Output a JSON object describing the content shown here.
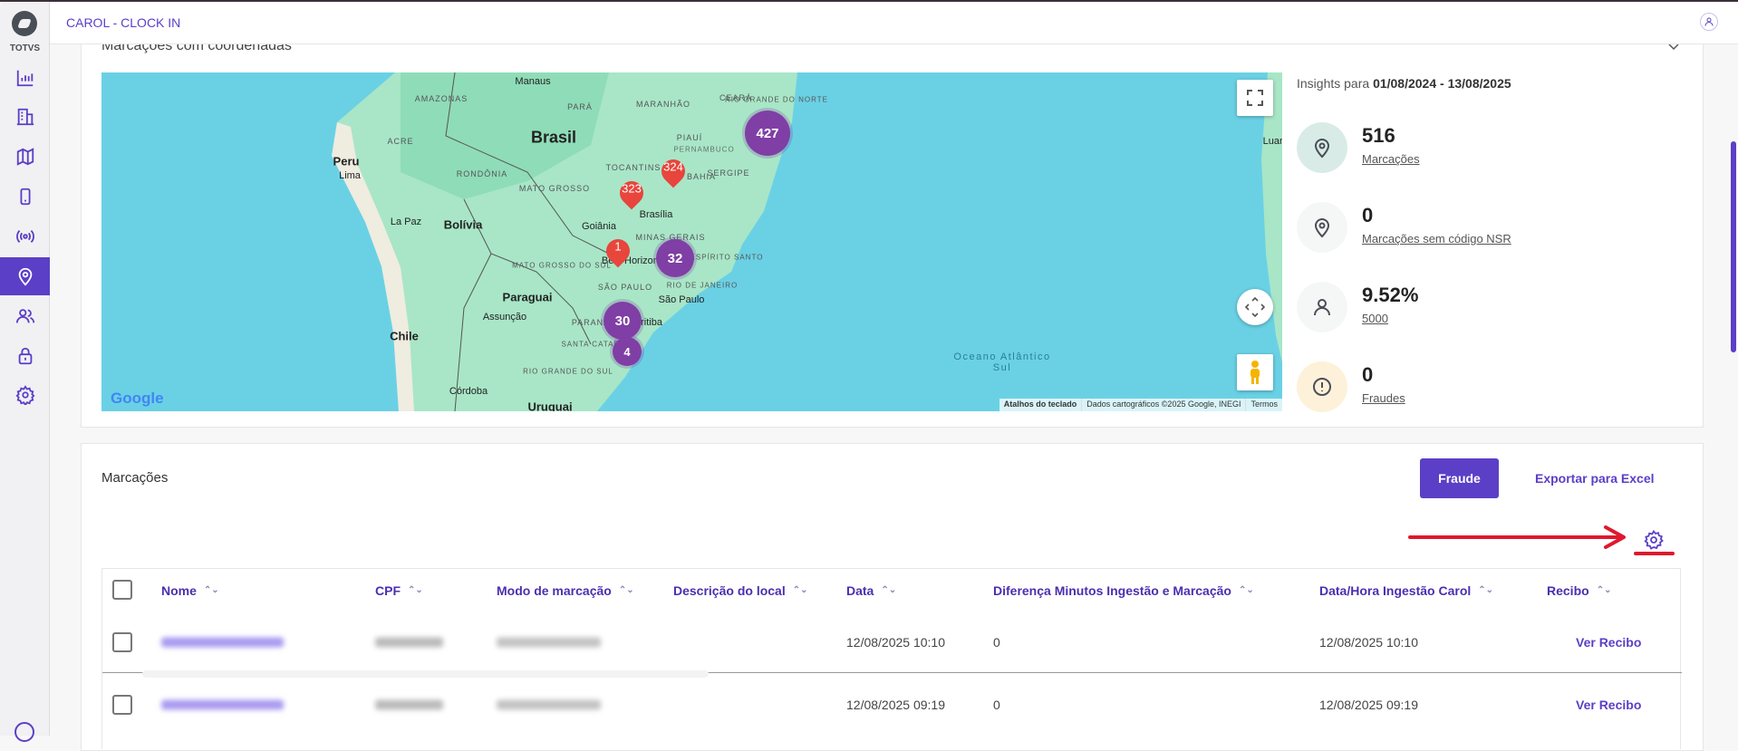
{
  "app": {
    "title": "CAROL - CLOCK IN",
    "brand": "TOTVS"
  },
  "sidebar": {
    "items": [
      {
        "name": "dashboard",
        "icon": "bar-chart-icon"
      },
      {
        "name": "companies",
        "icon": "building-icon"
      },
      {
        "name": "map",
        "icon": "map-icon"
      },
      {
        "name": "devices",
        "icon": "mobile-icon"
      },
      {
        "name": "signal",
        "icon": "broadcast-icon"
      },
      {
        "name": "locations",
        "icon": "location-pin-icon",
        "active": true
      },
      {
        "name": "users",
        "icon": "users-icon"
      },
      {
        "name": "security",
        "icon": "lock-icon"
      },
      {
        "name": "settings",
        "icon": "gear-icon"
      }
    ]
  },
  "map_card": {
    "title": "Marcações com coordenadas",
    "labels": {
      "countries": [
        "Brasil",
        "Peru",
        "Bolívia",
        "Paraguai",
        "Chile",
        "Uruguai"
      ],
      "cities": [
        "Manaus",
        "Lima",
        "La Paz",
        "Brasília",
        "Goiânia",
        "São Paulo",
        "Assunção",
        "Córdoba",
        "Belo Horizonte",
        "Curitiba",
        "Luanda"
      ],
      "states": [
        "AMAZONAS",
        "PARÁ",
        "MARANHÃO",
        "CEARÁ",
        "RIO GRANDE DO NORTE",
        "PIAUÍ",
        "PERNAMBUCO",
        "ACRE",
        "RONDÔNIA",
        "TOCANTINS",
        "BAHIA",
        "SERGIPE",
        "MATO GROSSO",
        "MINAS GERAIS",
        "ESPÍRITO SANTO",
        "MATO GROSSO DO SUL",
        "SÃO PAULO",
        "RIO DE JANEIRO",
        "PARANÁ",
        "SANTA CATARINA",
        "RIO GRANDE DO SUL"
      ],
      "ocean": "Oceano Atlântico Sul"
    },
    "clusters": [
      "427",
      "32",
      "30",
      "4"
    ],
    "pins": [
      "324",
      "323",
      "1"
    ],
    "google": "Google",
    "attribution": [
      "Atalhos do teclado",
      "Dados cartográficos ©2025 Google, INEGI",
      "Termos"
    ]
  },
  "insights": {
    "prefix": "Insights para",
    "range": "01/08/2024 - 13/08/2025",
    "items": [
      {
        "value": "516",
        "label": "Marcações",
        "icon": "location-pin-icon",
        "bg": "#d9ebe6"
      },
      {
        "value": "0",
        "label": "Marcações sem código NSR",
        "icon": "location-pin-icon",
        "bg": "#f5f7f7"
      },
      {
        "value": "9.52%",
        "label": "5000",
        "icon": "user-icon",
        "bg": "#f5f7f7"
      },
      {
        "value": "0",
        "label": "Fraudes",
        "icon": "alert-icon",
        "bg": "#fdf1d9"
      }
    ]
  },
  "marcacoes": {
    "title": "Marcações",
    "fraude_label": "Fraude",
    "export_label": "Exportar para Excel",
    "columns": [
      "Nome",
      "CPF",
      "Modo de marcação",
      "Descrição do local",
      "Data",
      "Diferença Minutos Ingestão e Marcação",
      "Data/Hora Ingestão Carol",
      "Recibo"
    ],
    "rows": [
      {
        "data": "12/08/2025 10:10",
        "diferenca": "0",
        "ingestao": "12/08/2025 10:10",
        "recibo": "Ver Recibo"
      },
      {
        "data": "12/08/2025 09:19",
        "diferenca": "0",
        "ingestao": "12/08/2025 09:19",
        "recibo": "Ver Recibo"
      }
    ]
  },
  "colors": {
    "accent": "#5b3fc7",
    "cluster": "#7f3fa5",
    "pin": "#e8453c",
    "annotation": "#e0182d"
  }
}
